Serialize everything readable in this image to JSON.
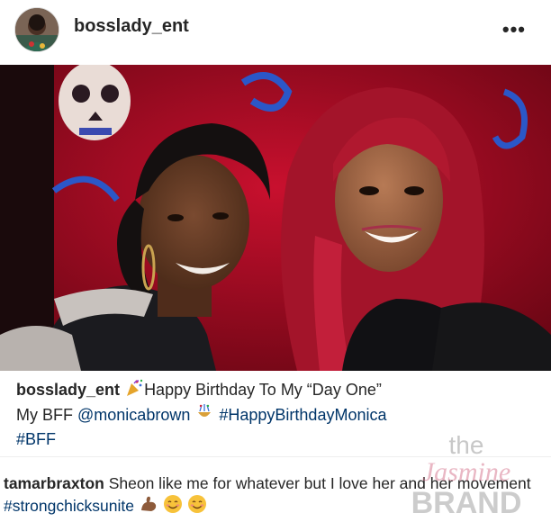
{
  "post": {
    "username": "bosslady_ent",
    "more_icon": "more-dots-icon"
  },
  "caption": {
    "username": "bosslady_ent",
    "text_1": "Happy Birthday To My “Day One”",
    "text_2": "My BFF",
    "mention": "@monicabrown",
    "hashtag_1": "#HappyBirthdayMonica",
    "hashtag_2": "#BFF"
  },
  "comment": {
    "username": "tamarbraxton",
    "text": "Sheon like me for whatever but I love her and her movement",
    "hashtag": "#strongchicksunite"
  },
  "watermark": {
    "line1": "the",
    "line2": "Jasmine",
    "line3": "BRAND"
  }
}
